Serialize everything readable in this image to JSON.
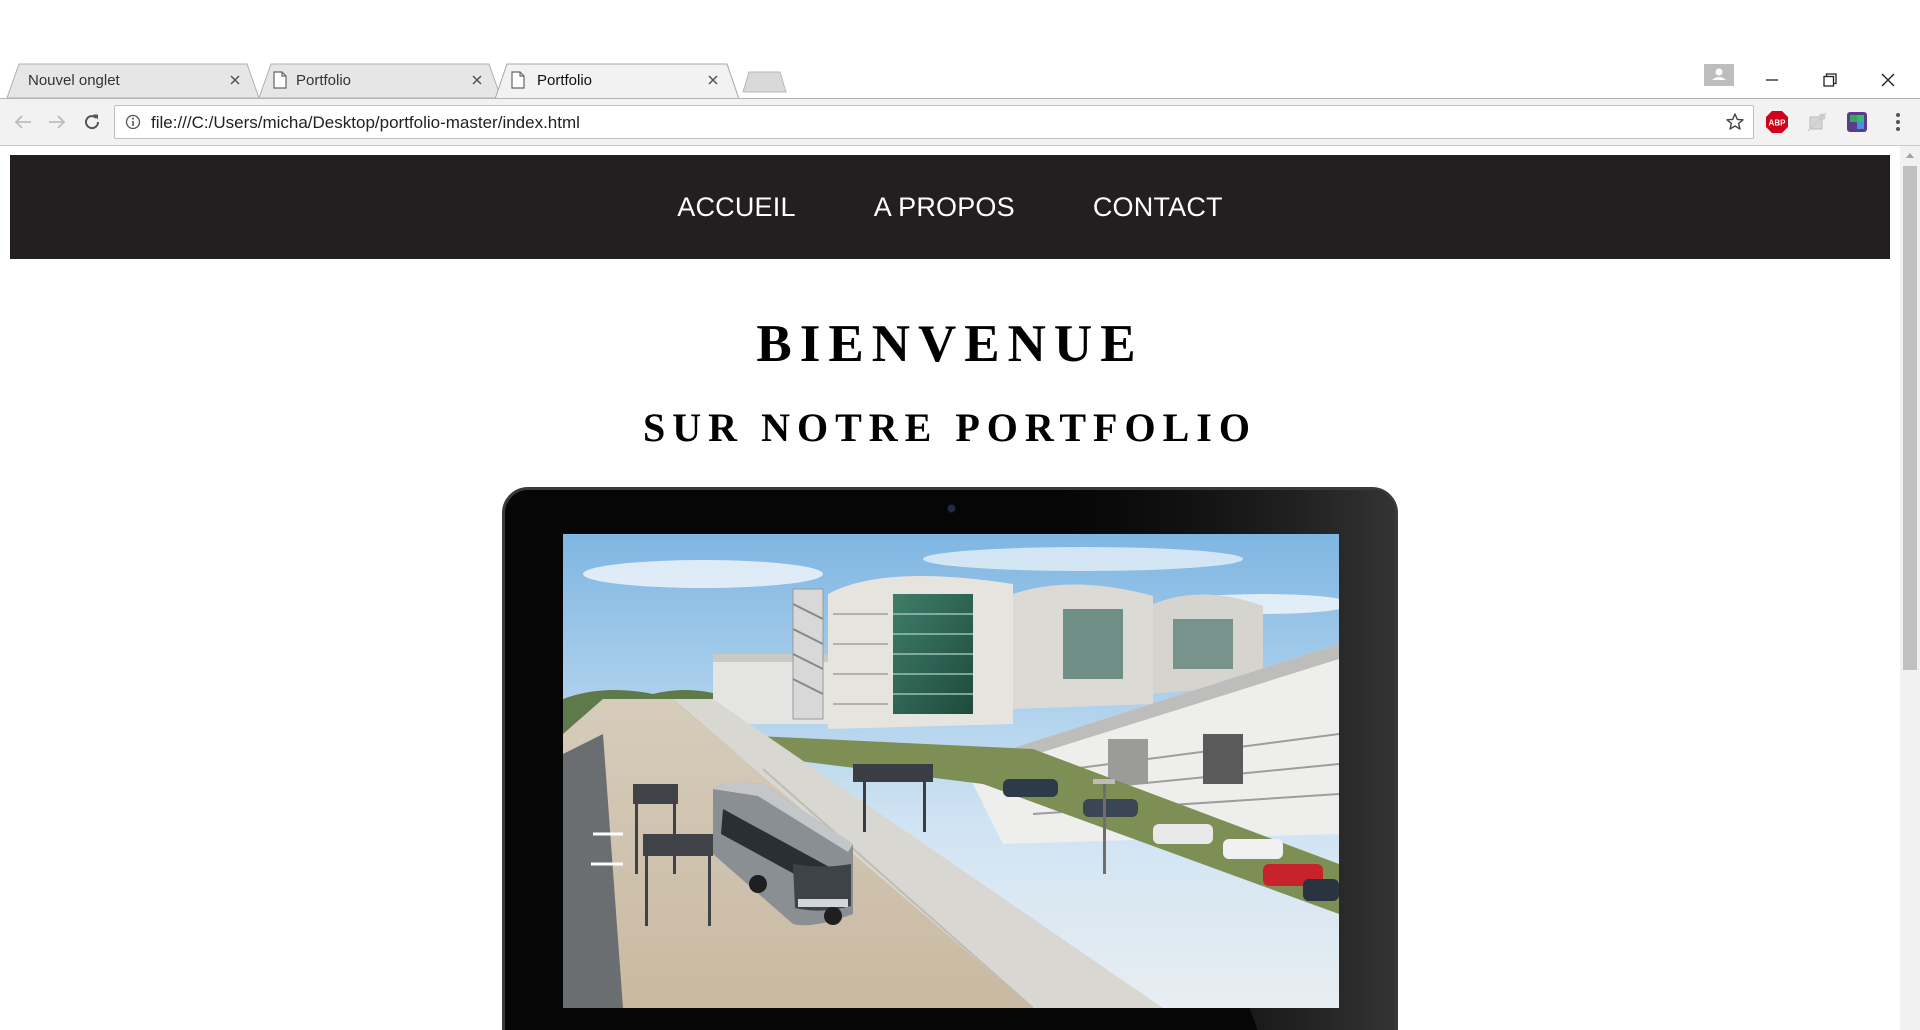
{
  "browser": {
    "tabs": [
      {
        "title": "Nouvel onglet",
        "has_favicon": false,
        "active": false
      },
      {
        "title": "Portfolio",
        "has_favicon": true,
        "active": false
      },
      {
        "title": "Portfolio",
        "has_favicon": true,
        "active": true
      }
    ],
    "url": "file:///C:/Users/micha/Desktop/portfolio-master/index.html",
    "extensions": [
      "adblock-plus-icon",
      "puzzle-extension-icon",
      "colorful-extension-icon"
    ],
    "window_controls": [
      "minimize",
      "restore",
      "close"
    ],
    "extension_label_abp": "ABP"
  },
  "site": {
    "nav": [
      "ACCUEIL",
      "A PROPOS",
      "CONTACT"
    ],
    "hero": {
      "title": "BIENVENUE",
      "subtitle": "SUR NOTRE PORTFOLIO"
    },
    "image": {
      "description_icon": "campus-bus-photo"
    }
  },
  "colors": {
    "nav_background": "#231f20",
    "nav_text": "#ffffff",
    "page_background": "#ffffff",
    "heading_text": "#000000",
    "toolbar_background": "#f2f2f2",
    "laptop_frame": "#060606"
  }
}
